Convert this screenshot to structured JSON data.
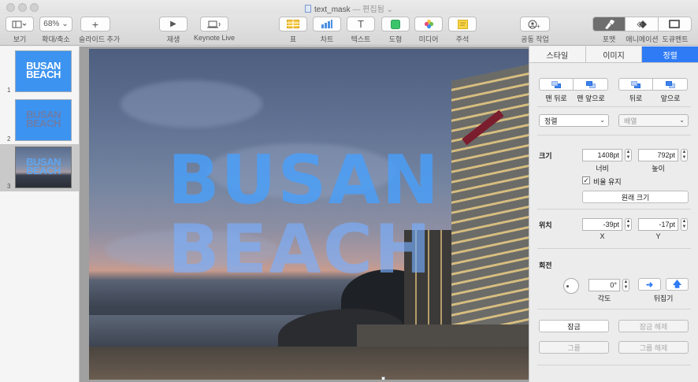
{
  "window": {
    "title": "text_mask",
    "title_sep": " — ",
    "title_status": "편집됨",
    "title_chevron": "⌄"
  },
  "toolbar": {
    "view_label": "보기",
    "zoom_value": "68%",
    "zoom_label": "확대/축소",
    "add_slide_label": "슬라이드 추가",
    "play_label": "재생",
    "keynote_live_label": "Keynote Live",
    "table_label": "표",
    "chart_label": "차트",
    "text_label": "텍스트",
    "shape_label": "도형",
    "media_label": "미디어",
    "comment_label": "주석",
    "collaborate_label": "공동 작업",
    "format_label": "포맷",
    "animate_label": "애니메이션",
    "document_label": "도큐멘트"
  },
  "navigator": {
    "slides": [
      {
        "number": "1",
        "line1": "BUSAN",
        "line2": "BEACH"
      },
      {
        "number": "2",
        "line1": "BUSAN",
        "line2": "BEACH"
      },
      {
        "number": "3",
        "line1": "BUSAN",
        "line2": "BEACH"
      }
    ]
  },
  "slide": {
    "title_line1": "BUSAN",
    "title_line2": "BEACH"
  },
  "inspector": {
    "tabs": [
      "스타일",
      "이미지",
      "정렬"
    ],
    "active_tab": "정렬",
    "arrange": {
      "back_most": "맨 뒤로",
      "front_most": "맨 앞으로",
      "backward": "뒤로",
      "forward": "앞으로"
    },
    "align_select": "정렬",
    "distribute_select": "배열",
    "size": {
      "heading": "크기",
      "width_value": "1408pt",
      "height_value": "792pt",
      "width_label": "너비",
      "height_label": "높이",
      "constrain_label": "비율 유지",
      "constrain_checked": true,
      "original_size": "원래 크기"
    },
    "position": {
      "heading": "위치",
      "x_value": "-39pt",
      "y_value": "-17pt",
      "x_label": "X",
      "y_label": "Y"
    },
    "rotate": {
      "heading": "회전",
      "angle_value": "0°",
      "angle_label": "각도",
      "flip_label": "뒤집기"
    },
    "lock": "잠금",
    "unlock": "잠금 해제",
    "group": "그룹",
    "ungroup": "그룹 해제"
  },
  "colors": {
    "accent": "#2f7bf5",
    "text_fill": "#46a0ff"
  }
}
